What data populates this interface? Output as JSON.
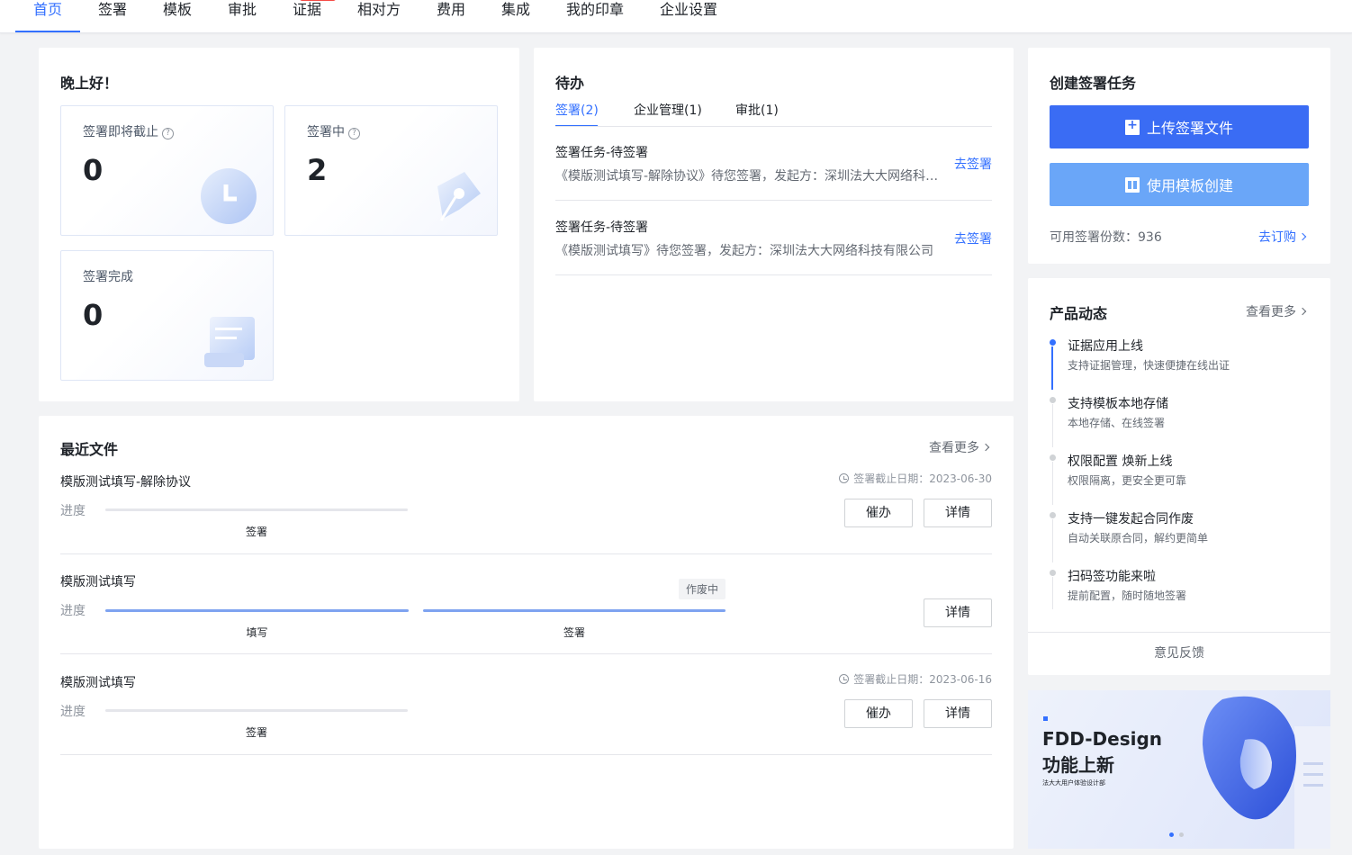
{
  "nav": {
    "items": [
      "首页",
      "签署",
      "模板",
      "审批",
      "证据",
      "相对方",
      "费用",
      "集成",
      "我的印章",
      "企业设置"
    ],
    "active": "首页"
  },
  "greeting": {
    "title": "晚上好！",
    "stats": [
      {
        "label": "签署即将截止",
        "value": "0",
        "help": true
      },
      {
        "label": "签署中",
        "value": "2",
        "help": true
      },
      {
        "label": "签署完成",
        "value": "0",
        "help": false
      }
    ]
  },
  "todo": {
    "title": "待办",
    "tabs": [
      "签署(2)",
      "企业管理(1)",
      "审批(1)"
    ],
    "items": [
      {
        "title": "签署任务-待签署",
        "desc": "《模版测试填写-解除协议》待您签署，发起方：深圳法大大网络科技有限公司",
        "action": "去签署"
      },
      {
        "title": "签署任务-待签署",
        "desc": "《模版测试填写》待您签署，发起方：深圳法大大网络科技有限公司",
        "action": "去签署"
      }
    ]
  },
  "create": {
    "title": "创建签署任务",
    "upload_label": "上传签署文件",
    "template_label": "使用模板创建",
    "quota_label": "可用签署份数：",
    "quota_value": "936",
    "subscribe_label": "去订购"
  },
  "updates": {
    "title": "产品动态",
    "more_label": "查看更多",
    "items": [
      {
        "title": "证据应用上线",
        "desc": "支持证据管理，快速便捷在线出证"
      },
      {
        "title": "支持模板本地存储",
        "desc": "本地存储、在线签署"
      },
      {
        "title": "权限配置 焕新上线",
        "desc": "权限隔离，更安全更可靠"
      },
      {
        "title": "支持一键发起合同作废",
        "desc": "自动关联原合同，解约更简单"
      },
      {
        "title": "扫码签功能来啦",
        "desc": "提前配置，随时随地签署"
      }
    ],
    "feedback_label": "意见反馈"
  },
  "recent": {
    "title": "最近文件",
    "more_label": "查看更多",
    "progress_label": "进度",
    "files": [
      {
        "name": "模版测试填写-解除协议",
        "deadline": "签署截止日期：2023-06-30",
        "steps": [
          "签署"
        ],
        "urge": "催办",
        "detail": "详情"
      },
      {
        "name": "模版测试填写",
        "badge": "作废中",
        "steps": [
          "填写",
          "签署"
        ],
        "detail": "详情"
      },
      {
        "name": "模版测试填写",
        "deadline": "签署截止日期：2023-06-16",
        "steps": [
          "签署"
        ],
        "urge": "催办",
        "detail": "详情"
      }
    ]
  },
  "banner": {
    "title_line1": "FDD-Design",
    "title_line2": "功能上新",
    "subtitle": "法大大用户体验设计部"
  },
  "colors": {
    "accent": "#3370ff",
    "primary_button": "#3a6cf4",
    "secondary_button": "#6aa6f8",
    "danger": "#f54a45"
  }
}
